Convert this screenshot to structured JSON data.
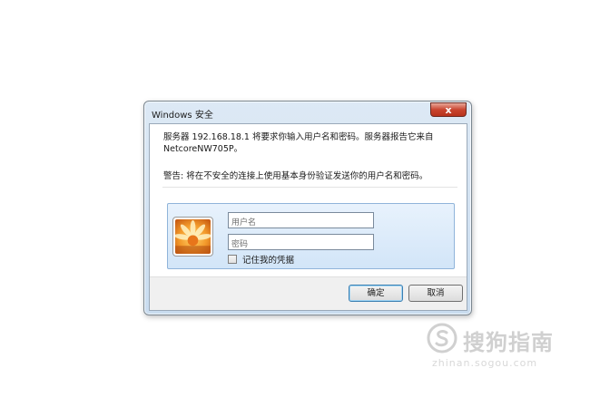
{
  "dialog": {
    "title": "Windows 安全",
    "close_label": "x",
    "message_line1": "服务器 192.168.18.1 将要求你输入用户名和密码。服务器报告它来自",
    "message_line2": "NetcoreNW705P。",
    "warning": "警告: 将在不安全的连接上使用基本身份验证发送你的用户名和密码。",
    "username_placeholder": "用户名",
    "password_placeholder": "密码",
    "remember_label": "记住我的凭据",
    "remember_checked": false,
    "ok_label": "确定",
    "cancel_label": "取消"
  },
  "watermark": {
    "logo_icon": "sogou-s-logo-icon",
    "text": "搜狗指南",
    "domain": "zhinan.sogou.com"
  },
  "colors": {
    "close_button": "#c9452f",
    "credential_panel": "#d2e5f8",
    "footer": "#f0f0f0"
  }
}
